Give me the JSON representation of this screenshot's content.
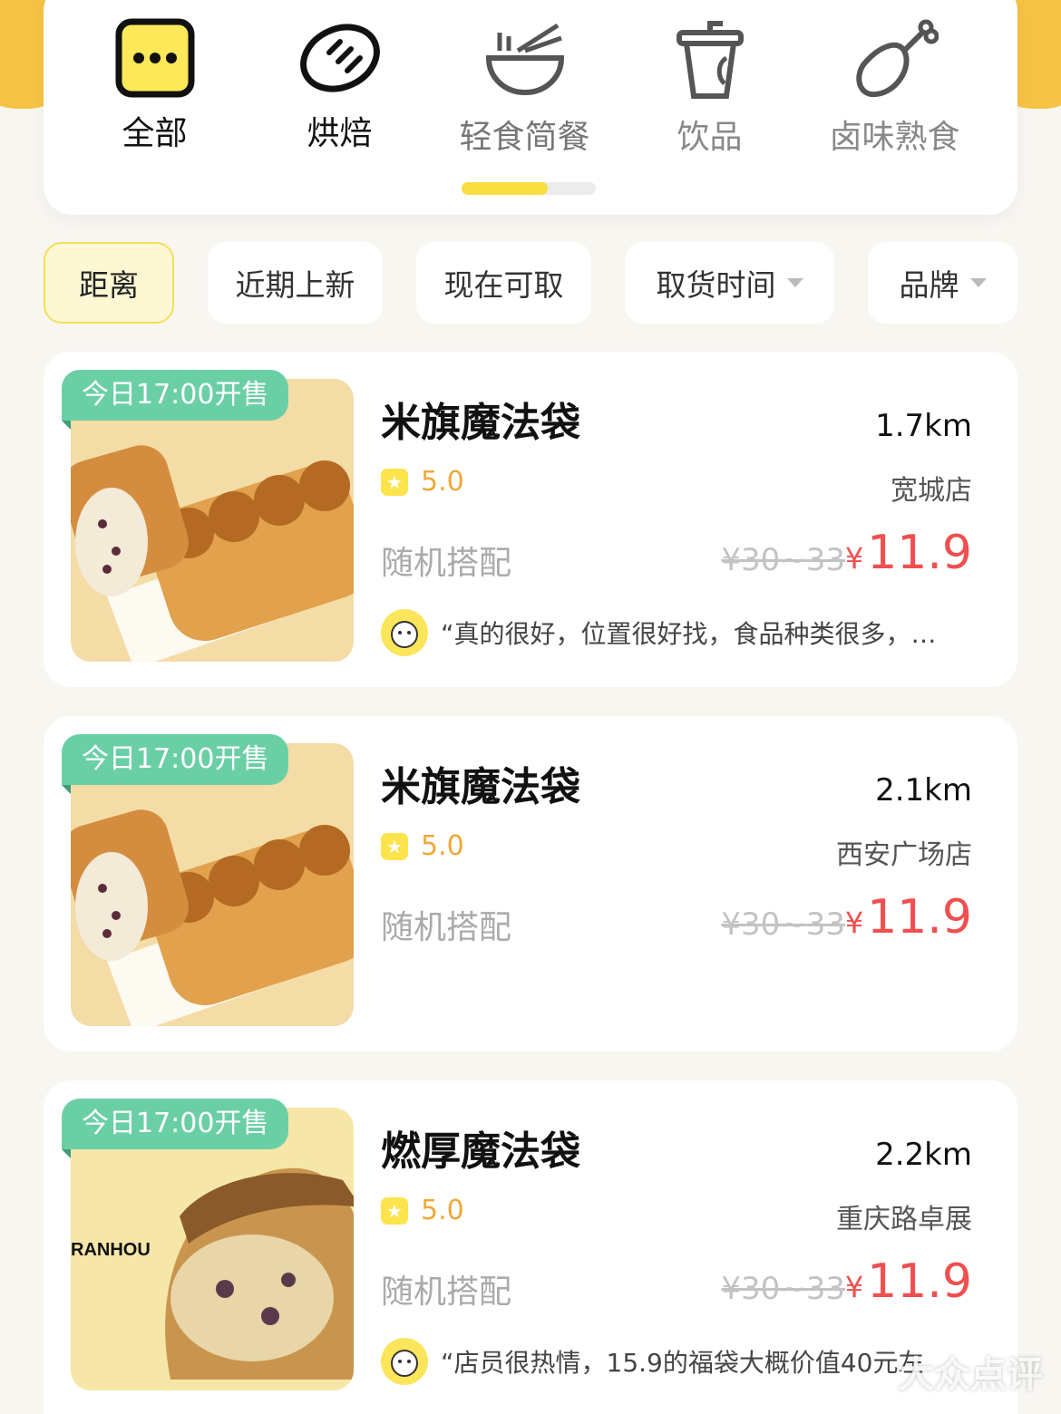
{
  "categories": [
    {
      "label": "全部",
      "icon": "more-dots-icon"
    },
    {
      "label": "烘焙",
      "icon": "bread-icon"
    },
    {
      "label": "轻食简餐",
      "icon": "noodle-bowl-icon"
    },
    {
      "label": "饮品",
      "icon": "drink-cup-icon"
    },
    {
      "label": "卤味熟食",
      "icon": "chicken-leg-icon"
    }
  ],
  "filters": [
    {
      "label": "距离"
    },
    {
      "label": "近期上新"
    },
    {
      "label": "现在可取"
    },
    {
      "label": "取货时间"
    },
    {
      "label": "品牌"
    }
  ],
  "items": [
    {
      "tag": "今日17:00开售",
      "title": "米旗魔法袋",
      "distance": "1.7km",
      "rating": "5.0",
      "store": "宽城店",
      "mix": "随机搭配",
      "orig_price": "¥30~33",
      "currency": "¥",
      "price": "11.9",
      "review": "“真的很好，位置很好找，食品种类很多，…"
    },
    {
      "tag": "今日17:00开售",
      "title": "米旗魔法袋",
      "distance": "2.1km",
      "rating": "5.0",
      "store": "西安广场店",
      "mix": "随机搭配",
      "orig_price": "¥30~33",
      "currency": "¥",
      "price": "11.9"
    },
    {
      "tag": "今日17:00开售",
      "title": "燃厚魔法袋",
      "distance": "2.2km",
      "rating": "5.0",
      "store": "重庆路卓展",
      "mix": "随机搭配",
      "orig_price": "¥30~33",
      "currency": "¥",
      "price": "11.9",
      "review": "“店员很热情，15.9的福袋大概价值40元左",
      "brand_text": "RANHOU"
    }
  ],
  "watermark": "大众点评"
}
